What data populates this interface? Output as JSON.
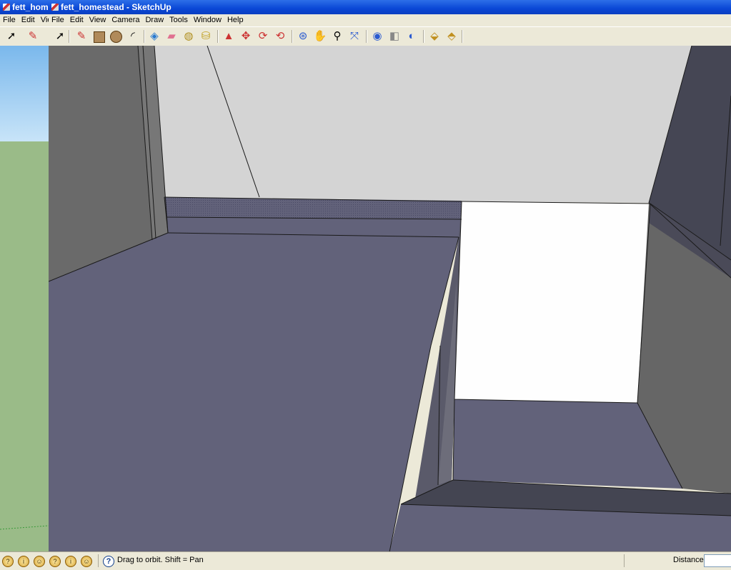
{
  "background_window": {
    "title": "fett_home",
    "menu": [
      "File",
      "Edit",
      "View"
    ]
  },
  "window": {
    "title": "fett_homestead - SketchUp",
    "menu": [
      "File",
      "Edit",
      "View",
      "Camera",
      "Draw",
      "Tools",
      "Window",
      "Help"
    ]
  },
  "toolbar": {
    "tools": [
      "select-tool",
      "eraser-tool",
      "line-tool",
      "rectangle-tool",
      "circle-tool",
      "arc-tool",
      "make-component-tool",
      "eraser-tool",
      "tape-measure-tool",
      "paint-bucket-tool",
      "push-pull-tool",
      "move-tool",
      "rotate-tool",
      "offset-tool",
      "orbit-tool",
      "pan-tool",
      "zoom-tool",
      "zoom-extents-tool",
      "get-models-tool",
      "share-model-tool",
      "google-earth-tool",
      "get-components-tool",
      "share-component-tool"
    ]
  },
  "status": {
    "message": "Drag to orbit.  Shift = Pan",
    "vcb_label": "Distance",
    "vcb_value": ""
  },
  "colors": {
    "sky": "#8cc4ec",
    "ground": "#9abb88",
    "floor": "#62627a",
    "ceiling": "#d4d4d4",
    "light_wall": "#fefefe",
    "dark_wall": "#454654"
  }
}
